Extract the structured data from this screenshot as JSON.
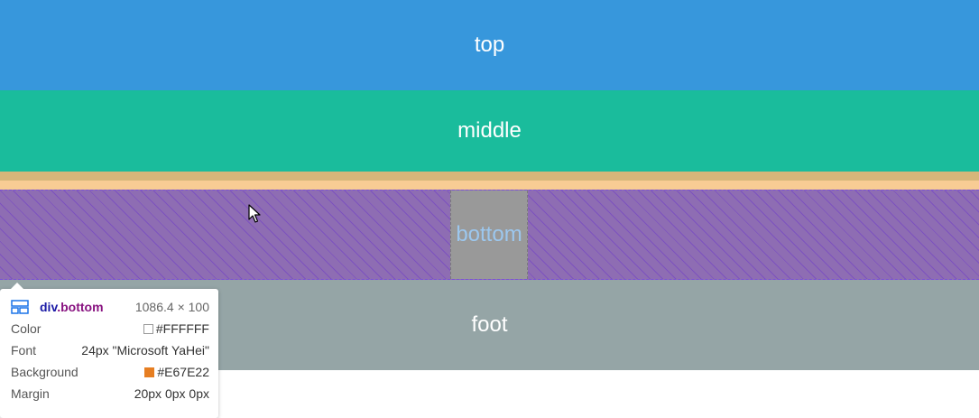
{
  "sections": {
    "top": {
      "label": "top",
      "color": "#3797DC"
    },
    "middle": {
      "label": "middle",
      "color": "#1ABC9C"
    },
    "bottom": {
      "label": "bottom",
      "color": "#8E6DB3",
      "content_color": "#999999",
      "text_color": "#9CC7EE"
    },
    "foot": {
      "label": "foot",
      "color": "#95A5A6"
    }
  },
  "margin_highlight": {
    "color_upper": "#D6B67A",
    "color_lower": "#F8CC94"
  },
  "inspector_tooltip": {
    "element_tag": "div",
    "element_class": ".bottom",
    "dimensions": "1086.4 × 100",
    "properties": [
      {
        "label": "Color",
        "value": "#FFFFFF",
        "swatch": "#FFFFFF"
      },
      {
        "label": "Font",
        "value": "24px \"Microsoft YaHei\""
      },
      {
        "label": "Background",
        "value": "#E67E22",
        "swatch": "#E67E22"
      },
      {
        "label": "Margin",
        "value": "20px 0px 0px"
      }
    ]
  }
}
